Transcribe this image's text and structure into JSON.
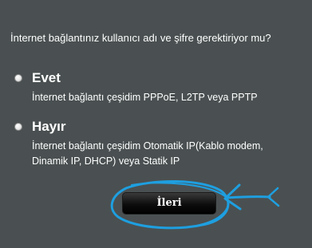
{
  "question": "İnternet bağlantınız kullanıcı adı ve şifre gerektiriyor mu?",
  "options": [
    {
      "title": "Evet",
      "description_lines": [
        "İnternet bağlantı çeşidim PPPoE, L2TP veya PPTP"
      ]
    },
    {
      "title": "Hayır",
      "description_lines": [
        "İnternet bağlantı çeşidim Otomatik IP(Kablo modem,",
        "Dinamik IP, DHCP) veya Statik IP"
      ]
    }
  ],
  "next_button_label": "İleri",
  "colors": {
    "background": "#4a5051",
    "text": "#ffffff",
    "button": "#0d0d0d",
    "annotation": "#1e9fe0"
  }
}
